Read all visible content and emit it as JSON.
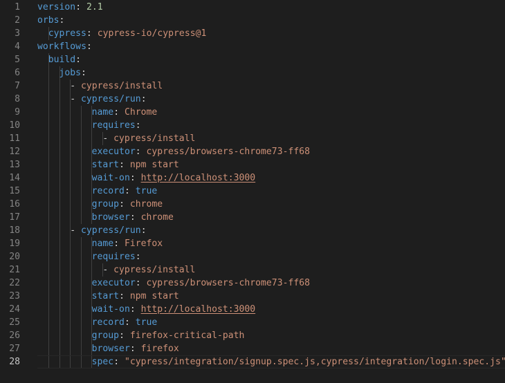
{
  "editor": {
    "lines": [
      {
        "n": "1",
        "indent": 0,
        "dash": false,
        "key": "version",
        "value": "2.1",
        "vtype": "num"
      },
      {
        "n": "2",
        "indent": 0,
        "dash": false,
        "key": "orbs",
        "value": "",
        "vtype": ""
      },
      {
        "n": "3",
        "indent": 1,
        "dash": false,
        "key": "cypress",
        "value": "cypress-io/cypress@1",
        "vtype": "str"
      },
      {
        "n": "4",
        "indent": 0,
        "dash": false,
        "key": "workflows",
        "value": "",
        "vtype": ""
      },
      {
        "n": "5",
        "indent": 1,
        "dash": false,
        "key": "build",
        "value": "",
        "vtype": ""
      },
      {
        "n": "6",
        "indent": 2,
        "dash": false,
        "key": "jobs",
        "value": "",
        "vtype": ""
      },
      {
        "n": "7",
        "indent": 3,
        "dash": true,
        "key": "",
        "value": "cypress/install",
        "vtype": "str"
      },
      {
        "n": "8",
        "indent": 3,
        "dash": true,
        "key": "cypress/run",
        "value": "",
        "vtype": ""
      },
      {
        "n": "9",
        "indent": 5,
        "dash": false,
        "key": "name",
        "value": "Chrome",
        "vtype": "str"
      },
      {
        "n": "10",
        "indent": 5,
        "dash": false,
        "key": "requires",
        "value": "",
        "vtype": ""
      },
      {
        "n": "11",
        "indent": 6,
        "dash": true,
        "key": "",
        "value": "cypress/install",
        "vtype": "str"
      },
      {
        "n": "12",
        "indent": 5,
        "dash": false,
        "key": "executor",
        "value": "cypress/browsers-chrome73-ff68",
        "vtype": "str"
      },
      {
        "n": "13",
        "indent": 5,
        "dash": false,
        "key": "start",
        "value": "npm start",
        "vtype": "str"
      },
      {
        "n": "14",
        "indent": 5,
        "dash": false,
        "key": "wait-on",
        "value": "http://localhost:3000",
        "vtype": "link"
      },
      {
        "n": "15",
        "indent": 5,
        "dash": false,
        "key": "record",
        "value": "true",
        "vtype": "bool"
      },
      {
        "n": "16",
        "indent": 5,
        "dash": false,
        "key": "group",
        "value": "chrome",
        "vtype": "str"
      },
      {
        "n": "17",
        "indent": 5,
        "dash": false,
        "key": "browser",
        "value": "chrome",
        "vtype": "str"
      },
      {
        "n": "18",
        "indent": 3,
        "dash": true,
        "key": "cypress/run",
        "value": "",
        "vtype": ""
      },
      {
        "n": "19",
        "indent": 5,
        "dash": false,
        "key": "name",
        "value": "Firefox",
        "vtype": "str"
      },
      {
        "n": "20",
        "indent": 5,
        "dash": false,
        "key": "requires",
        "value": "",
        "vtype": ""
      },
      {
        "n": "21",
        "indent": 6,
        "dash": true,
        "key": "",
        "value": "cypress/install",
        "vtype": "str"
      },
      {
        "n": "22",
        "indent": 5,
        "dash": false,
        "key": "executor",
        "value": "cypress/browsers-chrome73-ff68",
        "vtype": "str"
      },
      {
        "n": "23",
        "indent": 5,
        "dash": false,
        "key": "start",
        "value": "npm start",
        "vtype": "str"
      },
      {
        "n": "24",
        "indent": 5,
        "dash": false,
        "key": "wait-on",
        "value": "http://localhost:3000",
        "vtype": "link"
      },
      {
        "n": "25",
        "indent": 5,
        "dash": false,
        "key": "record",
        "value": "true",
        "vtype": "bool"
      },
      {
        "n": "26",
        "indent": 5,
        "dash": false,
        "key": "group",
        "value": "firefox-critical-path",
        "vtype": "str"
      },
      {
        "n": "27",
        "indent": 5,
        "dash": false,
        "key": "browser",
        "value": "firefox",
        "vtype": "str"
      },
      {
        "n": "28",
        "indent": 5,
        "dash": false,
        "key": "spec",
        "value": "\"cypress/integration/signup.spec.js,cypress/integration/login.spec.js\"",
        "vtype": "str",
        "current": true
      }
    ]
  },
  "colors": {
    "background": "#1e1e1e",
    "key": "#569cd6",
    "string": "#ce9178",
    "number": "#b5cea8",
    "line_number": "#858585",
    "indent_guide": "#404040"
  }
}
